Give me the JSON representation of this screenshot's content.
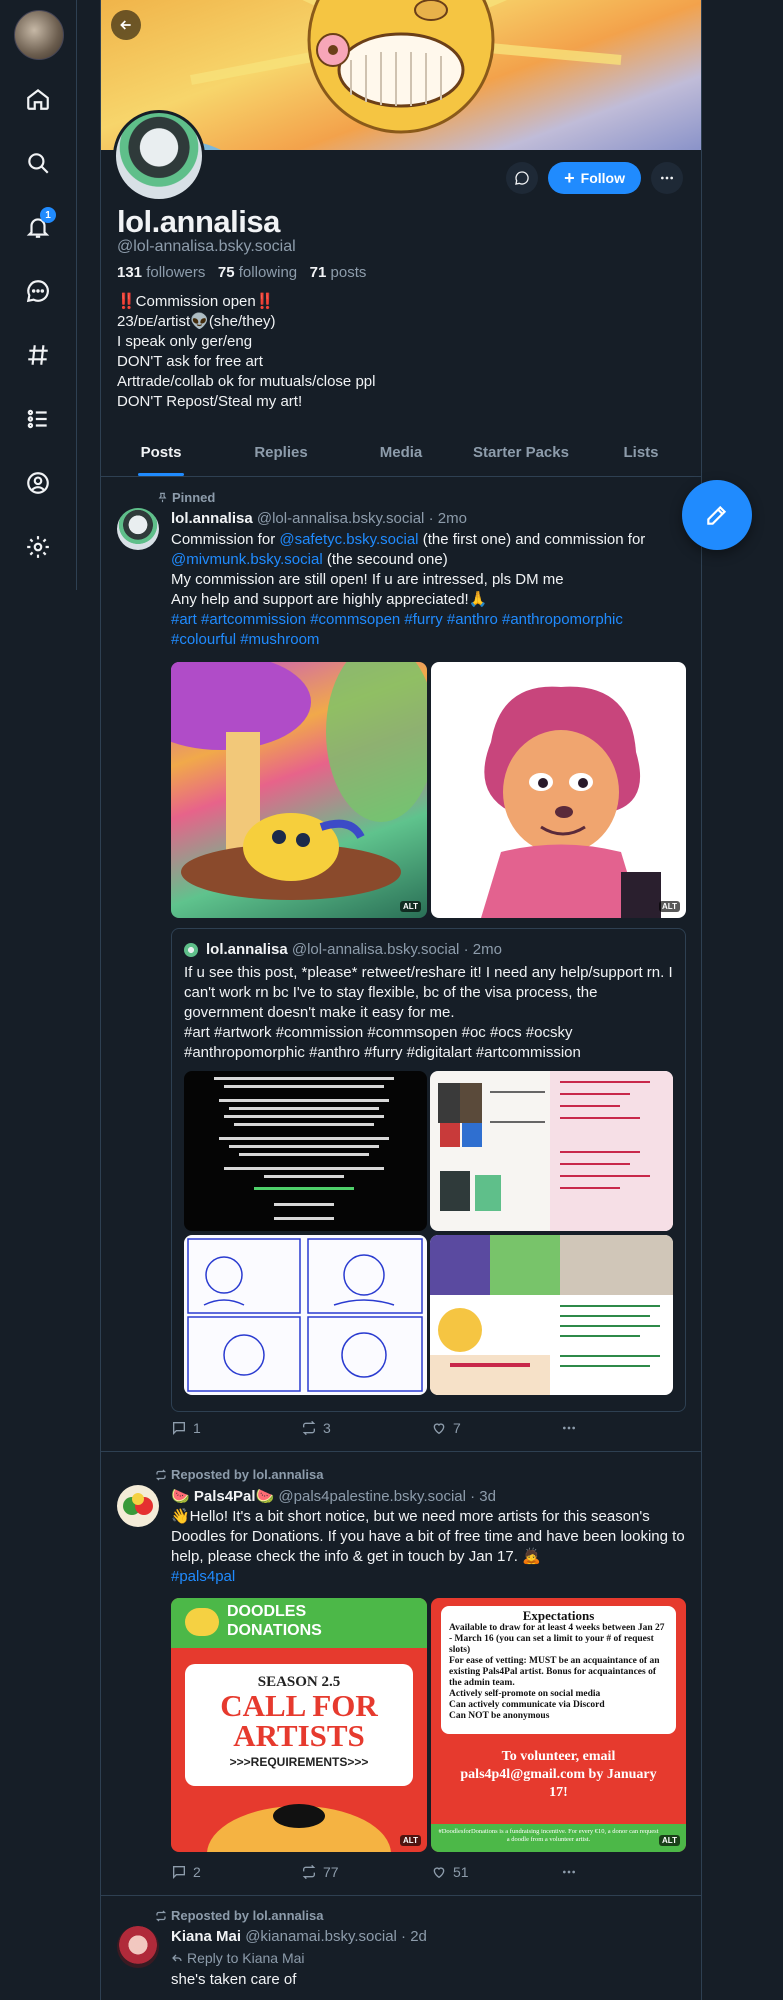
{
  "nav": {
    "notification_count": "1",
    "items": [
      "home-icon",
      "search-icon",
      "bell-icon",
      "chat-icon",
      "hashtag-icon",
      "list-icon",
      "profile-icon",
      "gear-icon"
    ]
  },
  "profile": {
    "display_name": "lol.annalisa",
    "handle": "@lol-annalisa.bsky.social",
    "followers_count": "131",
    "followers_label": "followers",
    "following_count": "75",
    "following_label": "following",
    "posts_count": "71",
    "posts_label": "posts",
    "follow_label": "Follow",
    "bio": "‼️Commission open‼️\n23/ᴅᴇ/artist👽(she/they)\nI speak only ger/eng\nDON'T ask for free art\nArttrade/collab ok for mutuals/close ppl\nDON'T Repost/Steal my art!"
  },
  "tabs": [
    "Posts",
    "Replies",
    "Media",
    "Starter Packs",
    "Lists"
  ],
  "posts": [
    {
      "context": "Pinned",
      "author": "lol.annalisa",
      "handle": "@lol-annalisa.bsky.social",
      "time": "· 2mo",
      "text_a": "Commission for ",
      "mention1": "@safetyc.bsky.social",
      "text_b": " (the first one) and commission for ",
      "mention2": "@mivmunk.bsky.social",
      "text_c": " (the secound one)\nMy commission are still open! If u are intressed, pls DM me\nAny help and support are highly appreciated!🙏",
      "tags": "#art #artcommission #commsopen #furry #anthro #anthropomorphic #colourful #mushroom",
      "alt": "ALT",
      "quote": {
        "author": "lol.annalisa",
        "handle": "@lol-annalisa.bsky.social",
        "time": "· 2mo",
        "text": "If u see this post, *please* retweet/reshare it! I need any help/support rn. I can't work rn bc I've to stay flexible, bc of the visa process, the government doesn't make it easy for me.\n#art #artwork #commission #commsopen #oc #ocs #ocsky #anthropomorphic #anthro #furry #digitalart #artcommission"
      },
      "replies": "1",
      "reposts": "3",
      "likes": "7"
    },
    {
      "context": "Reposted by lol.annalisa",
      "author": "🍉 Pals4Pal🍉",
      "handle": "@pals4palestine.bsky.social",
      "time": "· 3d",
      "text": "👋Hello! It's a bit short notice, but we need more artists for this season's Doodles for Donations. If you have a bit of free time and have been looking to help, please check the info & get in touch by Jan 17. 🙇",
      "tags": "#pals4pal",
      "img1": {
        "brand_line1": "DOODLES",
        "brand_line2": "DONATIONS",
        "season": "SEASON 2.5",
        "headline1": "CALL FOR",
        "headline2": "ARTISTS",
        "sub": ">>>REQUIREMENTS>>>"
      },
      "img2": {
        "title": "Expectations",
        "items": [
          "Available to draw for at least 4 weeks between Jan 27 - March 16 (you can set a limit to your # of request slots)",
          "For ease of vetting: MUST be an acquaintance of an existing Pals4Pal artist. Bonus for acquaintances of the admin team.",
          "Actively self-promote on social media",
          "Can actively communicate via Discord",
          "Can NOT be anonymous"
        ],
        "cta": "To volunteer, email pals4p4l@gmail.com by January 17!",
        "footer": "#DoodlesforDonations is a fundraising incentive. For every €10, a donor can request a doodle from a volunteer artist."
      },
      "replies": "2",
      "reposts": "77",
      "likes": "51"
    },
    {
      "context": "Reposted by lol.annalisa",
      "author": "Kiana Mai",
      "handle": "@kianamai.bsky.social",
      "time": "· 2d",
      "reply_to": "Reply to Kiana Mai",
      "text": "she's taken care of"
    }
  ],
  "colors": {
    "accent": "#208bfe",
    "background": "#161e27",
    "border": "#2e4052",
    "muted": "#8d9cab"
  }
}
